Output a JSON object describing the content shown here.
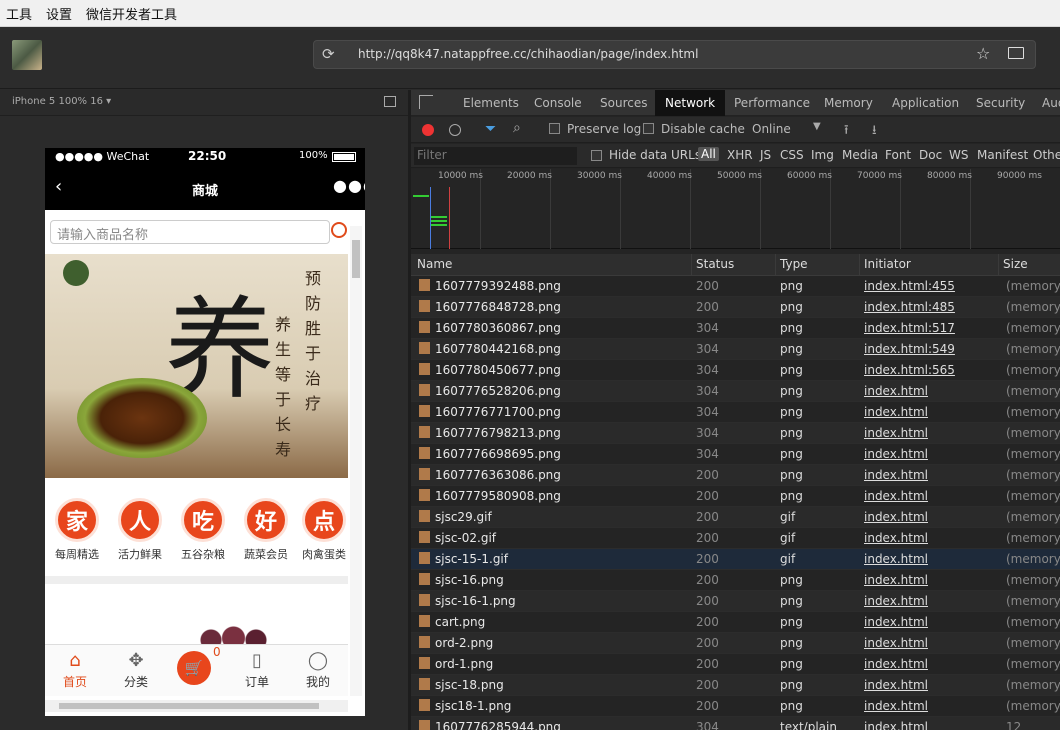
{
  "menubar": {
    "items": [
      "工具",
      "设置",
      "微信开发者工具"
    ]
  },
  "toolbar": {
    "url": "http://qq8k47.natappfree.cc/chihaodian/page/index.html"
  },
  "simulator": {
    "device_label": "iPhone 5 100% 16 ▾",
    "status": {
      "carrier": "●●●●● WeChat",
      "time": "22:50",
      "battery": "100%"
    },
    "nav": {
      "back": "‹",
      "title": "商城",
      "more": "●●●"
    },
    "search_placeholder": "请输入商品名称",
    "banner": {
      "big_char": "养",
      "poem_col1": "预防胜于治疗",
      "poem_col2": "养生等于长寿"
    },
    "categories": [
      {
        "char": "家",
        "label": "每周精选"
      },
      {
        "char": "人",
        "label": "活力鲜果"
      },
      {
        "char": "吃",
        "label": "五谷杂粮"
      },
      {
        "char": "好",
        "label": "蔬菜会员"
      },
      {
        "char": "点",
        "label": "肉禽蛋类"
      }
    ],
    "tabs": [
      {
        "icon": "⌂",
        "label": "首页"
      },
      {
        "icon": "✥",
        "label": "分类"
      },
      {
        "icon": "🛒",
        "label": ""
      },
      {
        "icon": "▯",
        "label": "订单"
      },
      {
        "icon": "◯",
        "label": "我的"
      }
    ],
    "cart_badge": "0"
  },
  "devtools": {
    "tabs": [
      "Elements",
      "Console",
      "Sources",
      "Network",
      "Performance",
      "Memory",
      "Application",
      "Security",
      "Aud"
    ],
    "active_tab": "Network",
    "network_toolbar": {
      "preserve_log": "Preserve log",
      "disable_cache": "Disable cache",
      "throttle": "Online"
    },
    "filter": {
      "placeholder": "Filter",
      "hide_data_urls": "Hide data URLs",
      "types": [
        "All",
        "XHR",
        "JS",
        "CSS",
        "Img",
        "Media",
        "Font",
        "Doc",
        "WS",
        "Manifest",
        "Other"
      ]
    },
    "timeline_ticks": [
      "10000 ms",
      "20000 ms",
      "30000 ms",
      "40000 ms",
      "50000 ms",
      "60000 ms",
      "70000 ms",
      "80000 ms",
      "90000 ms"
    ],
    "columns": [
      "Name",
      "Status",
      "Type",
      "Initiator",
      "Size"
    ],
    "rows": [
      {
        "name": "1607779392488.png",
        "status": "200",
        "type": "png",
        "initiator": "index.html:455",
        "size": "(memory c"
      },
      {
        "name": "1607776848728.png",
        "status": "200",
        "type": "png",
        "initiator": "index.html:485",
        "size": "(memory c"
      },
      {
        "name": "1607780360867.png",
        "status": "304",
        "type": "png",
        "initiator": "index.html:517",
        "size": "(memory c"
      },
      {
        "name": "1607780442168.png",
        "status": "304",
        "type": "png",
        "initiator": "index.html:549",
        "size": "(memory c"
      },
      {
        "name": "1607780450677.png",
        "status": "304",
        "type": "png",
        "initiator": "index.html:565",
        "size": "(memory c"
      },
      {
        "name": "1607776528206.png",
        "status": "304",
        "type": "png",
        "initiator": "index.html",
        "size": "(memory c"
      },
      {
        "name": "1607776771700.png",
        "status": "304",
        "type": "png",
        "initiator": "index.html",
        "size": "(memory c"
      },
      {
        "name": "1607776798213.png",
        "status": "304",
        "type": "png",
        "initiator": "index.html",
        "size": "(memory c"
      },
      {
        "name": "1607776698695.png",
        "status": "304",
        "type": "png",
        "initiator": "index.html",
        "size": "(memory c"
      },
      {
        "name": "1607776363086.png",
        "status": "200",
        "type": "png",
        "initiator": "index.html",
        "size": "(memory c"
      },
      {
        "name": "1607779580908.png",
        "status": "200",
        "type": "png",
        "initiator": "index.html",
        "size": "(memory c"
      },
      {
        "name": "sjsc29.gif",
        "status": "200",
        "type": "gif",
        "initiator": "index.html",
        "size": "(memory c"
      },
      {
        "name": "sjsc-02.gif",
        "status": "200",
        "type": "gif",
        "initiator": "index.html",
        "size": "(memory c"
      },
      {
        "name": "sjsc-15-1.gif",
        "status": "200",
        "type": "gif",
        "initiator": "index.html",
        "size": "(memory c"
      },
      {
        "name": "sjsc-16.png",
        "status": "200",
        "type": "png",
        "initiator": "index.html",
        "size": "(memory c"
      },
      {
        "name": "sjsc-16-1.png",
        "status": "200",
        "type": "png",
        "initiator": "index.html",
        "size": "(memory c"
      },
      {
        "name": "cart.png",
        "status": "200",
        "type": "png",
        "initiator": "index.html",
        "size": "(memory c"
      },
      {
        "name": "ord-2.png",
        "status": "200",
        "type": "png",
        "initiator": "index.html",
        "size": "(memory c"
      },
      {
        "name": "ord-1.png",
        "status": "200",
        "type": "png",
        "initiator": "index.html",
        "size": "(memory c"
      },
      {
        "name": "sjsc-18.png",
        "status": "200",
        "type": "png",
        "initiator": "index.html",
        "size": "(memory c"
      },
      {
        "name": "sjsc18-1.png",
        "status": "200",
        "type": "png",
        "initiator": "index.html",
        "size": "(memory c"
      },
      {
        "name": "1607776285944.png",
        "status": "304",
        "type": "text/plain",
        "initiator": "index.html",
        "size": "12"
      }
    ]
  }
}
